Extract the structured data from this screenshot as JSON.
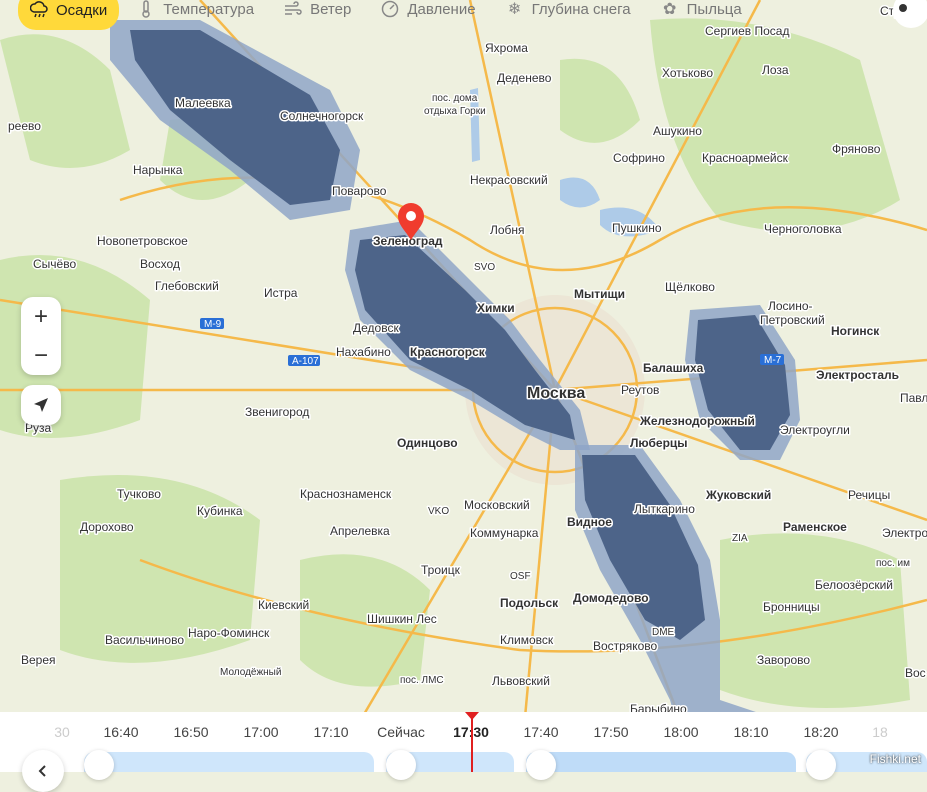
{
  "tabs": [
    {
      "label": "Осадки",
      "icon": "rain-cloud-icon",
      "active": true
    },
    {
      "label": "Температура",
      "icon": "thermometer-icon"
    },
    {
      "label": "Ветер",
      "icon": "wind-icon"
    },
    {
      "label": "Давление",
      "icon": "gauge-icon"
    },
    {
      "label": "Глубина снега",
      "icon": "snowflake-icon"
    },
    {
      "label": "Пыльца",
      "icon": "pollen-icon"
    }
  ],
  "map": {
    "labels": {
      "yahroma": "Яхрома",
      "sergiev": "Сергиев Посад",
      "strunino": "Струнин",
      "dedenevo": "Деденево",
      "hotkovo": "Хотьково",
      "loza": "Лоза",
      "malееvka": "Малеевка",
      "solnechnogorsk": "Солнечногорск",
      "posdoma": "пос. дома",
      "otdyha": "отдыха Горки",
      "ashukino": "Ашукино",
      "sofrino": "Софрино",
      "krasnoarmeysk": "Красноармейск",
      "fryanovo": "Фряново",
      "reevo": "реево",
      "narynka": "Нарынка",
      "nekrasovskiy": "Некрасовский",
      "povarovo": "Поварово",
      "lobnya": "Лобня",
      "pushkino": "Пушкино",
      "chernogolovka": "Черноголовка",
      "zelenograd": "Зеленоград",
      "novopetrovskoe": "Новопетровское",
      "sychevo": "Сычёво",
      "voskhod": "Восход",
      "svo": "SVO",
      "mytishchi": "Мытищи",
      "schelkovo": "Щёлково",
      "glebovskiy": "Глебовский",
      "istra": "Истра",
      "khimki": "Химки",
      "losino": "Лосино-",
      "petrovskiy": "Петровский",
      "noginsk": "Ногинск",
      "dedovsk": "Дедовск",
      "nakhabino": "Нахабино",
      "krasnogorsk": "Красногорск",
      "balashikha": "Балашиха",
      "elektrostal": "Электросталь",
      "reutov": "Реутов",
      "moskva": "Москва",
      "pavl": "Павл",
      "zvenigorod": "Звенигород",
      "zheleznodorozhny": "Железнодорожный",
      "elektrougli": "Электроугли",
      "ruza": "Руза",
      "odintsovo": "Одинцово",
      "lyubertsy": "Люберцы",
      "tuchkovo": "Тучково",
      "krasnoznamensk": "Краснознаменск",
      "zhukovskiy": "Жуковский",
      "rechitsy": "Речицы",
      "vko": "VKO",
      "moskovskiy": "Московский",
      "dorokhovo": "Дорохово",
      "kubinka": "Кубинка",
      "vidnoe": "Видное",
      "lytkarino": "Лыткарино",
      "ramenskoe": "Раменское",
      "aprelevka": "Апрелевка",
      "kommunarka": "Коммунарка",
      "zia": "ZIA",
      "elektro": "Электро",
      "troitsk": "Троицк",
      "osf": "OSF",
      "posim": "пос. им",
      "belozersky": "Белоозёрский",
      "podolsk": "Подольск",
      "domodedovo": "Домодедово",
      "kievskiy": "Киевский",
      "naro": "Наро-Фоминск",
      "shishkin": "Шишкин Лес",
      "klimovsk": "Климовск",
      "dme": "DME",
      "bronnitsy": "Бронницы",
      "vasilchinovo": "Васильчиново",
      "vostryakovo": "Востряково",
      "vereya": "Верея",
      "molodezhny": "Молодёжный",
      "zavorovo": "Заворово",
      "voskr": "Вос",
      "poslms": "пос. ЛМС",
      "lvovskiy": "Львовский",
      "barybino": "Барыбино",
      "m9": "М-9",
      "a107": "А-107",
      "m7": "М-7"
    },
    "zoom_in": "+",
    "zoom_out": "−"
  },
  "timeline": {
    "times": [
      "30",
      "16:40",
      "16:50",
      "17:00",
      "17:10",
      "Сейчас",
      "17:30",
      "17:40",
      "17:50",
      "18:00",
      "18:10",
      "18:20",
      "18"
    ],
    "now_label": "Сейчас",
    "current": "17:30"
  },
  "watermark": "Fishki.net"
}
